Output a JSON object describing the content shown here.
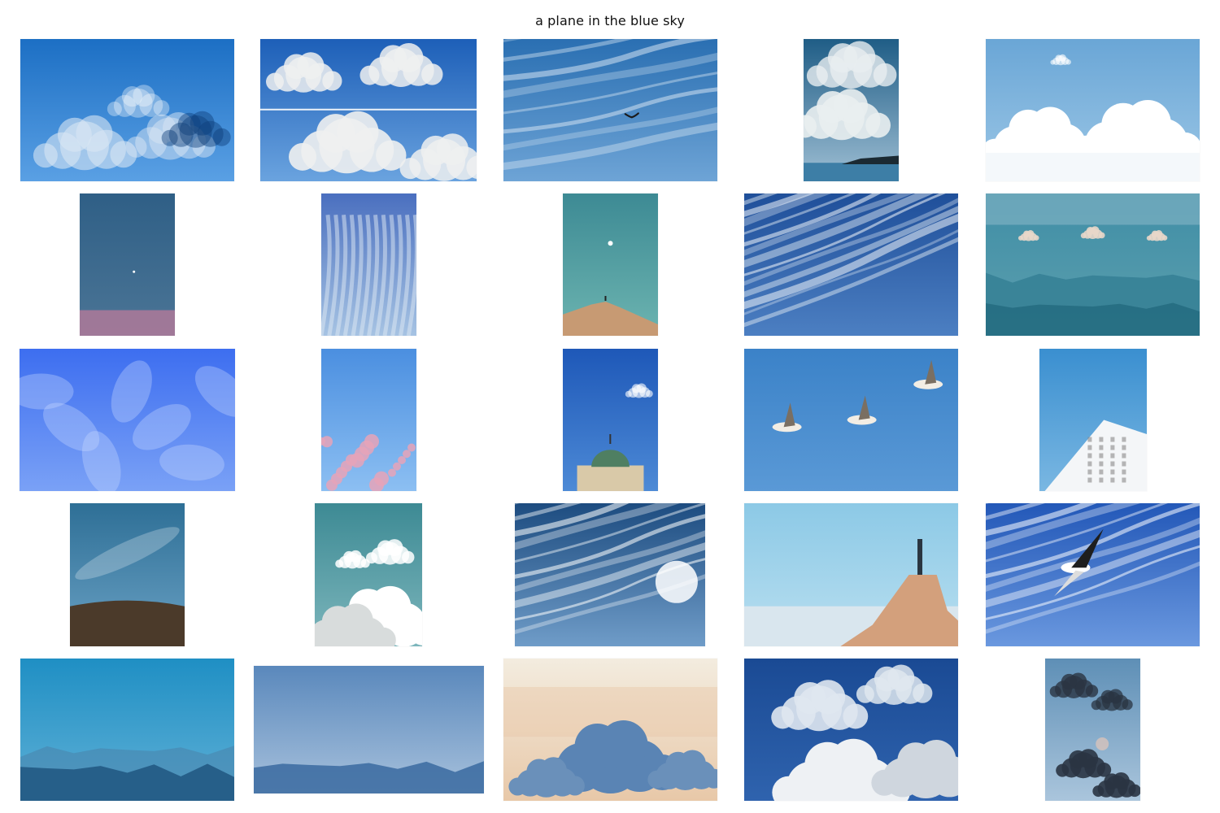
{
  "page": {
    "title": "a plane in the blue sky"
  },
  "grid": {
    "rows": 5,
    "columns": 5,
    "images": [
      {
        "name": "cloudy-blue-sky-photo",
        "kind": "clouds",
        "colors": [
          "#1c6fc4",
          "#5aa0e4",
          "#d9e6f3"
        ]
      },
      {
        "name": "contrail-across-clouds-photo",
        "kind": "contrail",
        "colors": [
          "#1d5fb8",
          "#6aa3df",
          "#eef0f0"
        ]
      },
      {
        "name": "lone-bird-in-wispy-sky-photo",
        "kind": "bird-wisps",
        "colors": [
          "#2a6fb2",
          "#6ea4d6",
          "#c9dcee"
        ]
      },
      {
        "name": "clouds-over-lake-shore-photo",
        "kind": "lake",
        "colors": [
          "#1f5d86",
          "#9fbfd4",
          "#e9eef0"
        ]
      },
      {
        "name": "white-cumulus-clouds-photo",
        "kind": "cumulus",
        "colors": [
          "#6aa6d6",
          "#9cc7e6",
          "#ffffff"
        ]
      },
      {
        "name": "dusk-sky-tiny-moon-photo",
        "kind": "dusk",
        "colors": [
          "#2f5f86",
          "#4b7596",
          "#c47a9a"
        ]
      },
      {
        "name": "feathery-cirrus-clouds-photo",
        "kind": "cirrus-vertical",
        "colors": [
          "#4a6fbf",
          "#a6c3e3",
          "#dfeaf3"
        ]
      },
      {
        "name": "person-on-rock-with-moon-photo",
        "kind": "teal-rock",
        "colors": [
          "#3d8a94",
          "#6cb4b0",
          "#c79a73"
        ]
      },
      {
        "name": "streaky-cirrus-sky-photo",
        "kind": "cirrus-diagonal",
        "colors": [
          "#1f4f9a",
          "#4c7fc2",
          "#e6edf5"
        ]
      },
      {
        "name": "aerial-mountains-haze-photo",
        "kind": "aerial",
        "colors": [
          "#3f8ea6",
          "#5d9fae",
          "#e8d7c9"
        ]
      },
      {
        "name": "blue-flower-overlay-photo",
        "kind": "flowers",
        "colors": [
          "#3d6ef0",
          "#7aa1f6",
          "#c9d9ff"
        ]
      },
      {
        "name": "pink-cherry-blossom-sky-photo",
        "kind": "blossom",
        "colors": [
          "#4b8fe0",
          "#8cbff2",
          "#e6a3b8"
        ]
      },
      {
        "name": "domed-basilica-sky-photo",
        "kind": "basilica",
        "colors": [
          "#1e58b8",
          "#4d8ad6",
          "#d9c9a8"
        ]
      },
      {
        "name": "three-geese-flying-photo",
        "kind": "geese",
        "colors": [
          "#3b82c8",
          "#5a99d6",
          "#f2ede4"
        ]
      },
      {
        "name": "white-building-corner-sky-photo",
        "kind": "building",
        "colors": [
          "#3a8fd0",
          "#7ab7e2",
          "#f4f6f8"
        ]
      },
      {
        "name": "milky-way-over-hill-photo",
        "kind": "milkyway",
        "colors": [
          "#2e6f96",
          "#6aa1c4",
          "#4b3a2a"
        ]
      },
      {
        "name": "teal-sky-puffy-clouds-photo",
        "kind": "teal-clouds",
        "colors": [
          "#3d8a94",
          "#7db6bc",
          "#ffffff"
        ]
      },
      {
        "name": "sun-through-wispy-clouds-photo",
        "kind": "sun-wisps",
        "colors": [
          "#1d4c80",
          "#6f9cc8",
          "#f3f6f9"
        ]
      },
      {
        "name": "man-on-rock-pillar-photo",
        "kind": "rock-pillar",
        "colors": [
          "#8cc9e6",
          "#b9dff0",
          "#d3a07c"
        ]
      },
      {
        "name": "seagull-soaring-photo",
        "kind": "seagull",
        "colors": [
          "#2358b8",
          "#6a98df",
          "#eef3fb"
        ]
      },
      {
        "name": "misty-mountain-ranges-photo",
        "kind": "mountains",
        "colors": [
          "#1f8fc4",
          "#5fb0d6",
          "#245c86"
        ]
      },
      {
        "name": "pale-sky-mountain-silhouette-photo",
        "kind": "pale-mountains",
        "colors": [
          "#5a88bc",
          "#a7c1dc",
          "#3a6aa0"
        ]
      },
      {
        "name": "pastel-sunset-cloud-photo",
        "kind": "pastel",
        "colors": [
          "#f3ecdf",
          "#e8c8a8",
          "#5a84b4"
        ]
      },
      {
        "name": "dramatic-white-clouds-photo",
        "kind": "dramatic",
        "colors": [
          "#1a4a94",
          "#2f63ae",
          "#eef1f4"
        ]
      },
      {
        "name": "dark-storm-clouds-photo",
        "kind": "storm",
        "colors": [
          "#5e8fb6",
          "#aac5dc",
          "#2a3442"
        ]
      }
    ]
  }
}
